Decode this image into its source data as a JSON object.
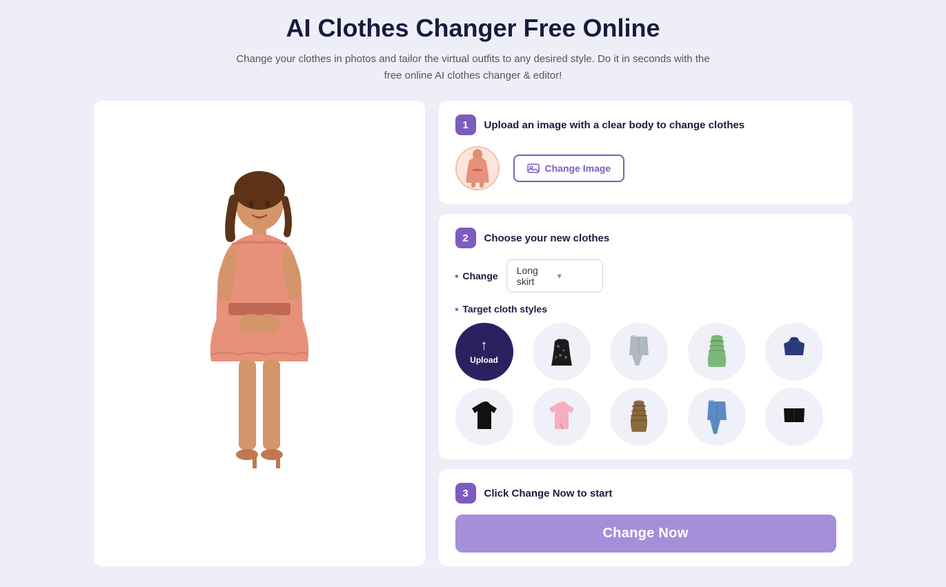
{
  "header": {
    "title": "AI Clothes Changer Free Online",
    "subtitle": "Change your clothes in photos and tailor the virtual outfits to any desired style. Do it in seconds with the free online AI clothes changer & editor!"
  },
  "steps": {
    "step1": {
      "badge": "1",
      "title": "Upload an image with a clear body to change clothes",
      "change_image_btn": "Change Image"
    },
    "step2": {
      "badge": "2",
      "title": "Choose your new clothes",
      "change_label": "Change",
      "dropdown_value": "Long skirt",
      "target_label": "Target cloth styles",
      "clothes": [
        {
          "id": "upload",
          "type": "upload",
          "label": "Upload"
        },
        {
          "id": "black-floral-skirt",
          "type": "item",
          "label": "Black floral skirt"
        },
        {
          "id": "grey-jeans",
          "type": "item",
          "label": "Grey wide jeans"
        },
        {
          "id": "green-dress",
          "type": "item",
          "label": "Green ruched dress"
        },
        {
          "id": "navy-top",
          "type": "item",
          "label": "Navy blue top"
        },
        {
          "id": "black-tshirt",
          "type": "item",
          "label": "Black t-shirt"
        },
        {
          "id": "pink-tshirt",
          "type": "item",
          "label": "Pink t-shirt"
        },
        {
          "id": "brown-dress",
          "type": "item",
          "label": "Brown ruched dress"
        },
        {
          "id": "blue-jeans",
          "type": "item",
          "label": "Blue jeans"
        },
        {
          "id": "black-shorts",
          "type": "item",
          "label": "Black shorts"
        }
      ]
    },
    "step3": {
      "badge": "3",
      "title": "Click Change Now to start",
      "button_label": "Change Now"
    }
  },
  "colors": {
    "purple": "#7c5cbf",
    "dark_purple": "#2d2060",
    "light_purple": "#a58fd8",
    "bg": "#eeeef8"
  }
}
